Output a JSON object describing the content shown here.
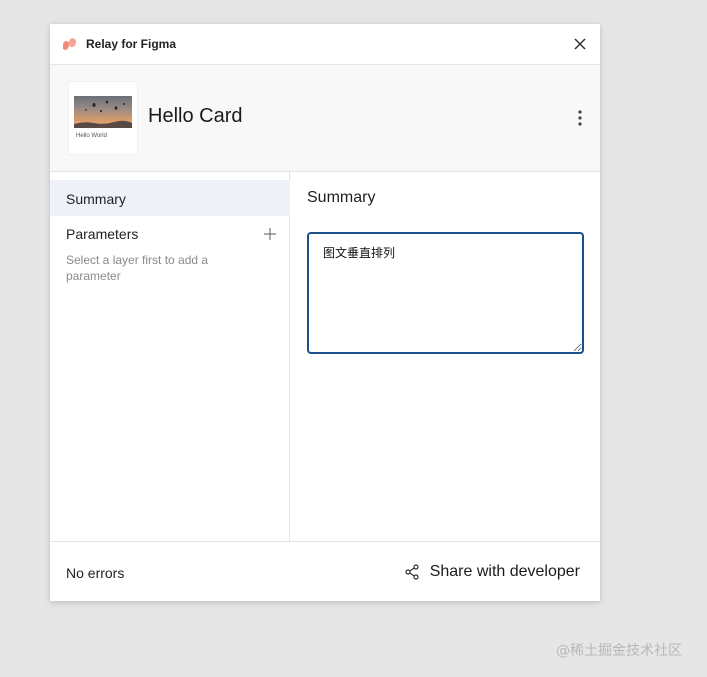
{
  "app": {
    "title": "Relay for Figma",
    "logo_icon": "relay-logo-icon",
    "close_icon": "close-icon"
  },
  "component": {
    "name": "Hello Card",
    "thumbnail_caption": "Hello World",
    "more_icon": "more-vertical-icon"
  },
  "sidebar": {
    "summary_label": "Summary",
    "parameters_label": "Parameters",
    "parameters_hint": "Select a layer first to add a parameter",
    "add_icon": "plus-icon"
  },
  "main": {
    "title": "Summary",
    "summary_value": "图文垂直排列"
  },
  "footer": {
    "status": "No errors",
    "share_label": "Share with developer",
    "share_icon": "share-icon"
  },
  "watermark": "@稀土掘金技术社区",
  "colors": {
    "accent_border": "#1a4f8b",
    "selected_bg": "#eef2f8",
    "logo": "#f08a7a"
  }
}
